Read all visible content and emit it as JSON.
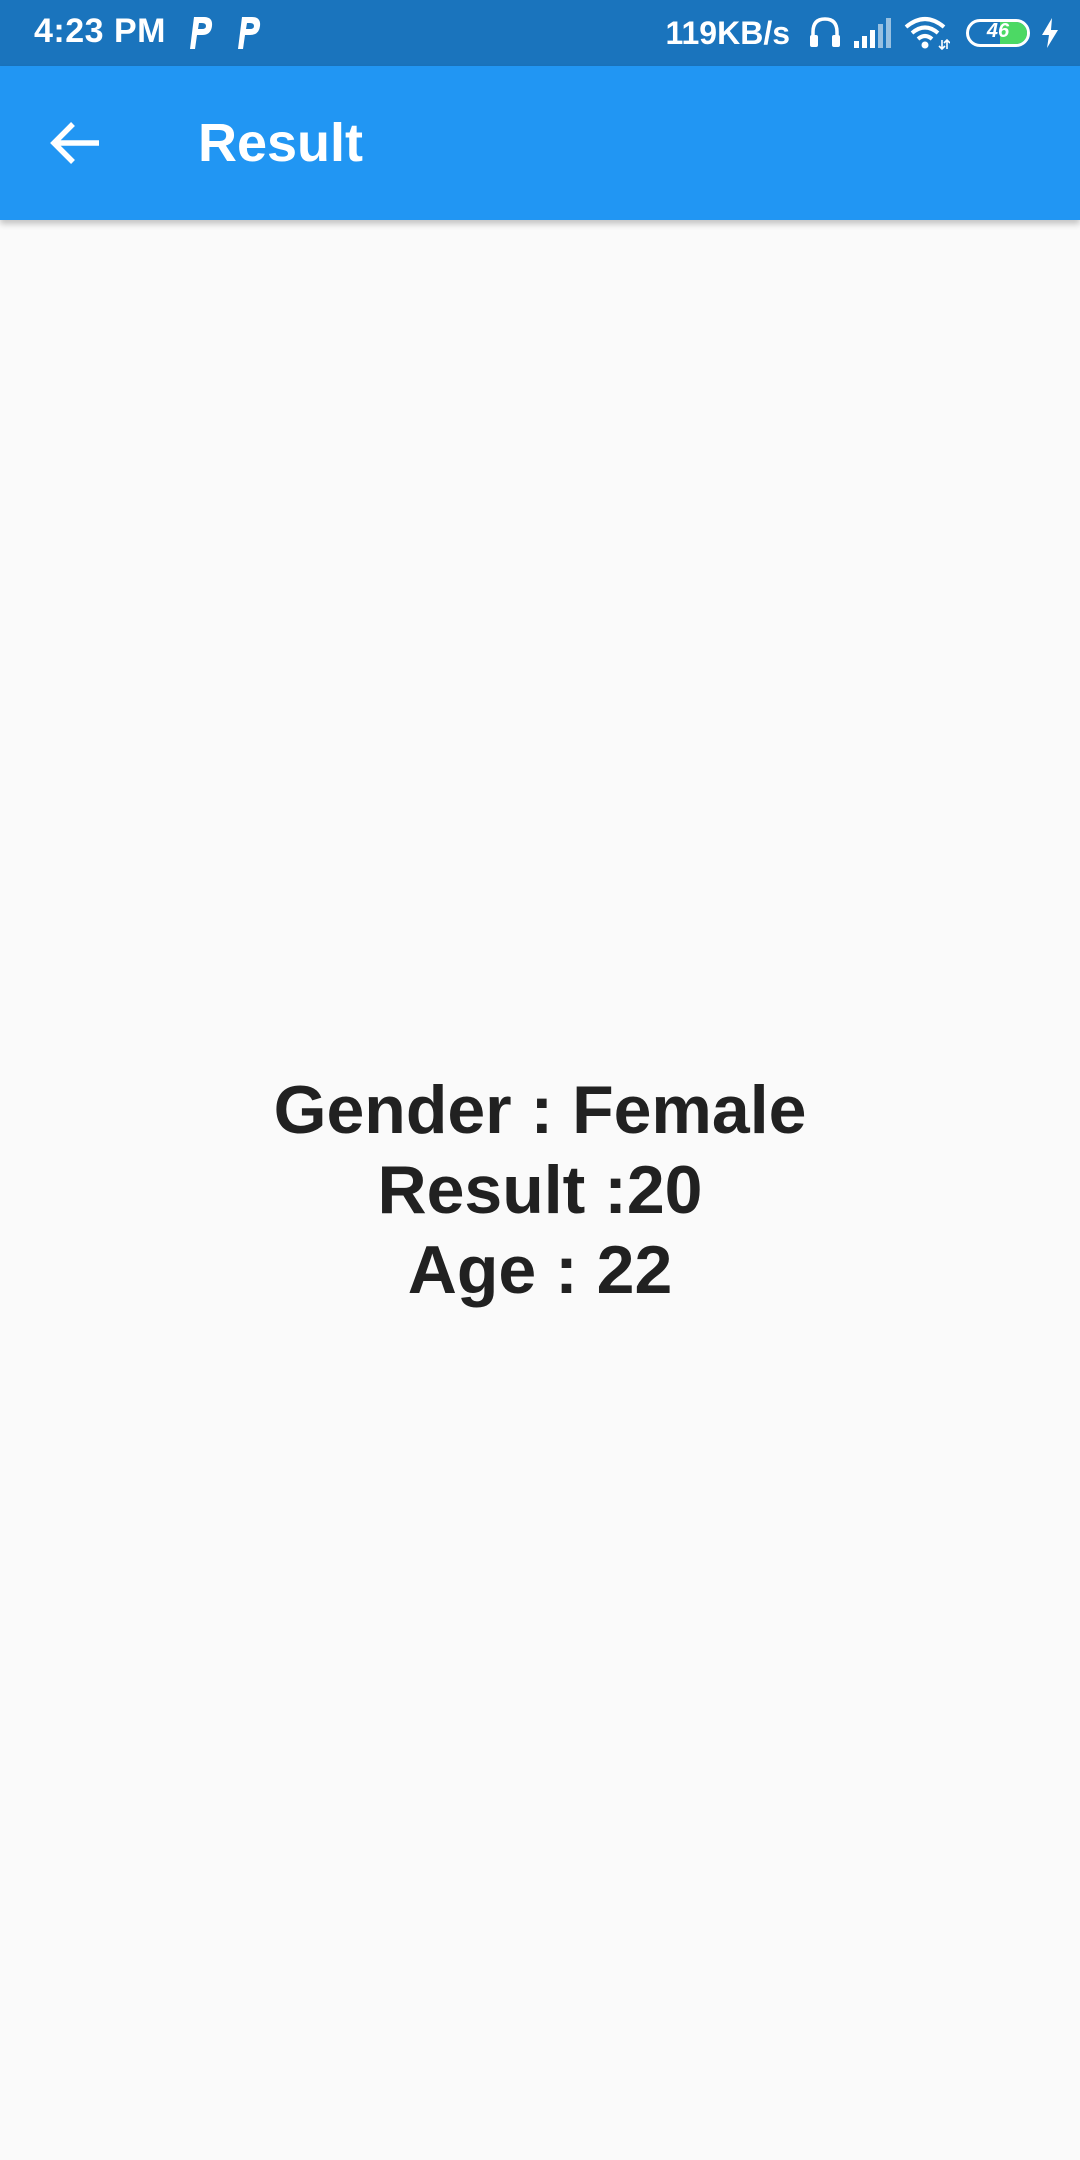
{
  "status_bar": {
    "time": "4:23 PM",
    "net_speed": "119KB/s",
    "battery_level": "46",
    "battery_fraction": 0.46,
    "icons": [
      "parking-notification-icon",
      "parking-notification-icon",
      "headset-icon",
      "signal-icon",
      "wifi-icon",
      "battery-icon",
      "charging-icon"
    ],
    "bg_color": "#1a74bd"
  },
  "app_bar": {
    "title": "Result",
    "back_icon": "arrow-left-icon",
    "bg_color": "#2196f3"
  },
  "content": {
    "gender_line": "Gender : Female",
    "result_line": "Result :20",
    "age_line": "Age : 22"
  }
}
